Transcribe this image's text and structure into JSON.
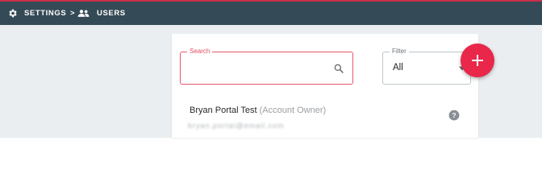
{
  "breadcrumb": {
    "settings": "SETTINGS",
    "separator": ">",
    "users": "USERS"
  },
  "search": {
    "label": "Search",
    "value": ""
  },
  "filter": {
    "label": "Filter",
    "value": "All"
  },
  "add_button": {
    "icon": "plus-icon"
  },
  "user": {
    "name": "Bryan Portal Test",
    "role": "(Account Owner)",
    "email": "bryan.portal@email.com"
  },
  "colors": {
    "topbar": "#344a56",
    "accent": "#e8274a",
    "background": "#eaeef1"
  }
}
